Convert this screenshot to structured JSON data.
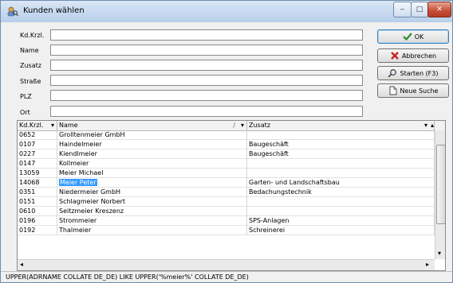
{
  "window": {
    "title": "Kunden wählen"
  },
  "form": {
    "fields": [
      {
        "label": "Kd.Krzl.",
        "value": ""
      },
      {
        "label": "Name",
        "value": ""
      },
      {
        "label": "Zusatz",
        "value": ""
      },
      {
        "label": "Straße",
        "value": ""
      },
      {
        "label": "PLZ",
        "value": ""
      },
      {
        "label": "Ort",
        "value": ""
      }
    ]
  },
  "buttons": {
    "ok": "OK",
    "cancel": "Abbrechen",
    "start": "Starten (F3)",
    "new_search": "Neue Suche"
  },
  "grid": {
    "columns": [
      "Kd.Krzl.",
      "Name",
      "Zusatz"
    ],
    "rows": [
      {
        "kd": "0652",
        "name": "Grolltenmeier GmbH",
        "zusatz": ""
      },
      {
        "kd": "0107",
        "name": "Haindelmeier",
        "zusatz": "Baugeschäft"
      },
      {
        "kd": "0227",
        "name": "Kiendlmeier",
        "zusatz": "Baugeschäft"
      },
      {
        "kd": "0147",
        "name": "Kollmeier",
        "zusatz": ""
      },
      {
        "kd": "13059",
        "name": "Meier Michael",
        "zusatz": ""
      },
      {
        "kd": "14068",
        "name": "Meier Peter",
        "zusatz": "Garten- und Landschaftsbau"
      },
      {
        "kd": "0351",
        "name": "Niedermeier GmbH",
        "zusatz": "Bedachungstechnik"
      },
      {
        "kd": "0151",
        "name": "Schlagmeier Norbert",
        "zusatz": ""
      },
      {
        "kd": "0610",
        "name": "Seitzmeier Kreszenz",
        "zusatz": ""
      },
      {
        "kd": "0196",
        "name": "Strommeier",
        "zusatz": "SPS-Anlagen"
      },
      {
        "kd": "0192",
        "name": "Thalmeier",
        "zusatz": "Schreinerei"
      }
    ],
    "selected_index": 5
  },
  "status": {
    "query": "UPPER(ADRNAME COLLATE DE_DE) LIKE UPPER('%meier%' COLLATE DE_DE)"
  },
  "colors": {
    "selection": "#3399ff",
    "close_button": "#c9523a"
  }
}
